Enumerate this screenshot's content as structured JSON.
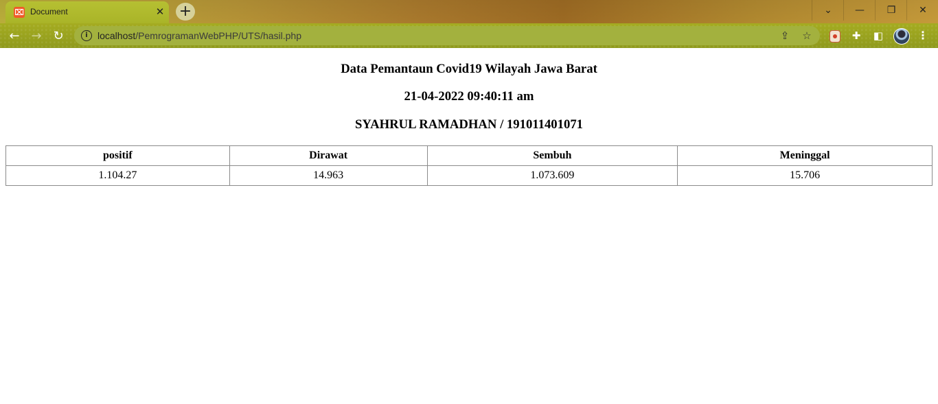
{
  "browser": {
    "tab_title": "Document",
    "tab_close": "✕",
    "new_tab": "+",
    "url_host": "localhost",
    "url_path": "/PemrogramanWebPHP/UTS/hasil.php",
    "icons": [
      "tab-search-icon",
      "minimize-icon",
      "restore-icon",
      "close-icon",
      "back-icon",
      "forward-icon",
      "reload-icon",
      "site-info-icon",
      "share-icon",
      "bookmark-star-icon",
      "extension-icon",
      "puzzle-icon",
      "side-panel-icon",
      "profile-avatar",
      "more-menu-icon"
    ]
  },
  "page": {
    "title": "Data Pemantaun Covid19 Wilayah Jawa Barat",
    "datetime": "21-04-2022 09:40:11 am",
    "author": "SYAHRUL RAMADHAN / 191011401071",
    "table": {
      "headers": [
        "positif",
        "Dirawat",
        "Sembuh",
        "Meninggal"
      ],
      "row": [
        "1.104.27",
        "14.963",
        "1.073.609",
        "15.706"
      ]
    }
  },
  "colors": {
    "chrome": "#a6ad21",
    "omnibox": "#a3b13e",
    "table_border": "#8a8a8a"
  }
}
